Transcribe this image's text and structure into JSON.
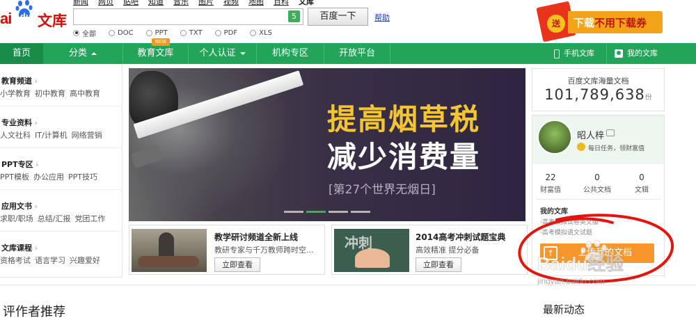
{
  "header": {
    "logo": {
      "bai": "ai",
      "du": "du",
      "wenku": "文库"
    },
    "top_nav": [
      "新闻",
      "网页",
      "贴吧",
      "知道",
      "音乐",
      "图片",
      "视频",
      "地图",
      "百科",
      "文库"
    ],
    "search": {
      "placeholder": "",
      "value": "",
      "count_badge": "5",
      "button_label": "百度一下"
    },
    "help_label": "帮助",
    "filters": [
      {
        "label": "全部",
        "checked": true
      },
      {
        "label": "DOC",
        "checked": false
      },
      {
        "label": "PPT",
        "checked": false
      },
      {
        "label": "TXT",
        "checked": false
      },
      {
        "label": "PDF",
        "checked": false
      },
      {
        "label": "XLS",
        "checked": false
      }
    ],
    "promo": {
      "circle": "送",
      "text_prefix": "下载",
      "text_highlight": "不用下载券"
    }
  },
  "navbar": {
    "items": [
      {
        "label": "首页"
      },
      {
        "label": "分类"
      },
      {
        "label": "教育文库",
        "badge": "NEW"
      },
      {
        "label": "个人认证"
      },
      {
        "label": "机构专区"
      },
      {
        "label": "开放平台"
      }
    ],
    "right": {
      "mobile": "手机文库",
      "mine": "我的文库"
    }
  },
  "sidebar": {
    "categories": [
      {
        "title": "教育频道",
        "links": [
          "小学教育",
          "初中教育",
          "高中教育"
        ]
      },
      {
        "title": "专业资料",
        "links": [
          "人文社科",
          "IT/计算机",
          "网络营销"
        ]
      },
      {
        "title": "PPT专区",
        "links": [
          "PPT模板",
          "办公应用",
          "PPT技巧"
        ]
      },
      {
        "title": "应用文书",
        "links": [
          "求职/职场",
          "总结/汇报",
          "党团工作"
        ]
      },
      {
        "title": "文库课程",
        "links": [
          "资格考试",
          "语言学习",
          "兴趣爱好"
        ]
      }
    ]
  },
  "banner": {
    "title_line1": "提高烟草税",
    "title_line2": "减少消费量",
    "subtitle": "[第27个世界无烟日]",
    "active_slide": 2,
    "slide_count": 4
  },
  "cards": [
    {
      "title": "教学研讨频道全新上线",
      "desc": "教研专家与千万教师跨时空...",
      "button": "立即查看"
    },
    {
      "title": "2014高考冲刺试题宝典",
      "desc": "高效精准 提分必备",
      "button": "立即查看",
      "image_text": "冲刺"
    }
  ],
  "right_panel": {
    "stats_label": "百度文库海量文档",
    "stats_number": "101,789,638",
    "stats_unit": "份",
    "user": {
      "name": "昭人梓",
      "task_text": "每日任务，领财富值",
      "stats": [
        {
          "value": "22",
          "label": "财富值"
        },
        {
          "value": "0",
          "label": "公共文档"
        },
        {
          "value": "0",
          "label": "文辑"
        }
      ]
    },
    "my_docs_title": "我的文库",
    "my_docs": [
      "高考模拟试卷英文版",
      "高考模拟语文试题"
    ],
    "upload_label": "上传我的文档"
  },
  "watermark": {
    "brand": "Baidu经验",
    "url": "jingyan.baidu.com"
  },
  "bottom": {
    "left_title": "评作者推荐",
    "right_title": "最新动态"
  },
  "colors": {
    "nav_green": "#23a559",
    "brand_red": "#e10601",
    "upload_orange": "#f7972b",
    "banner_yellow": "#f2c531"
  }
}
